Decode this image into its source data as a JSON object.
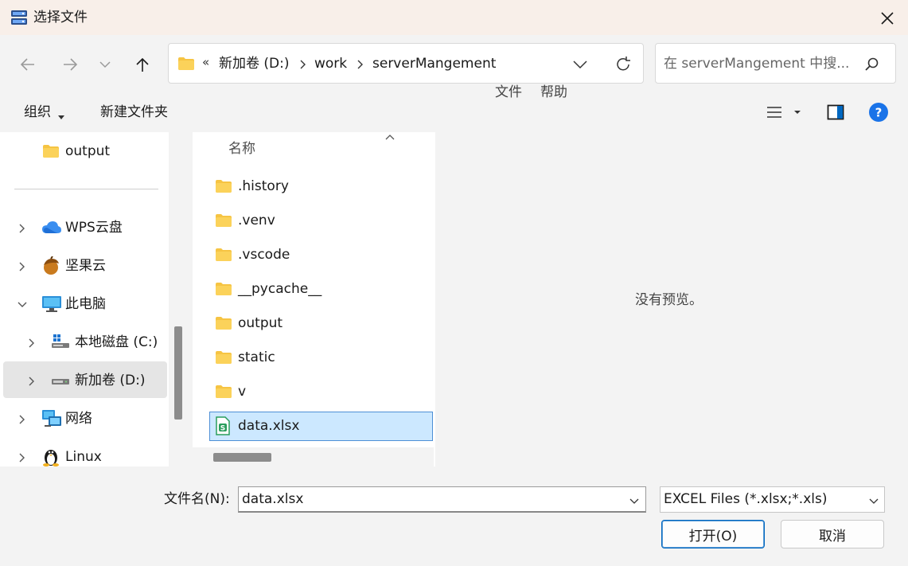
{
  "window": {
    "title": "选择文件"
  },
  "address": {
    "overflow": "«",
    "crumbs": [
      "新加卷 (D:)",
      "work",
      "serverMangement"
    ]
  },
  "search": {
    "placeholder": "在 serverMangement 中搜..."
  },
  "menu": {
    "file": "文件",
    "help": "帮助"
  },
  "toolbar": {
    "organize": "组织",
    "new_folder": "新建文件夹"
  },
  "sidebar": {
    "items": [
      {
        "label": "output",
        "icon": "folder-icon",
        "expandable": false
      },
      {
        "label": "WPS云盘",
        "icon": "cloud-icon",
        "expandable": true
      },
      {
        "label": "坚果云",
        "icon": "nut-icon",
        "expandable": true
      },
      {
        "label": "此电脑",
        "icon": "computer-icon",
        "expandable": true,
        "expanded": true
      },
      {
        "label": "本地磁盘 (C:)",
        "icon": "windows-drive-icon",
        "expandable": true
      },
      {
        "label": "新加卷 (D:)",
        "icon": "drive-icon",
        "expandable": true,
        "selected": true
      },
      {
        "label": "网络",
        "icon": "network-icon",
        "expandable": true
      },
      {
        "label": "Linux",
        "icon": "linux-penguin-icon",
        "expandable": true
      }
    ]
  },
  "files": {
    "column_name": "名称",
    "items": [
      {
        "name": ".history",
        "type": "folder"
      },
      {
        "name": ".venv",
        "type": "folder"
      },
      {
        "name": ".vscode",
        "type": "folder"
      },
      {
        "name": "__pycache__",
        "type": "folder"
      },
      {
        "name": "output",
        "type": "folder"
      },
      {
        "name": "static",
        "type": "folder"
      },
      {
        "name": "v",
        "type": "folder"
      },
      {
        "name": "data.xlsx",
        "type": "spreadsheet",
        "selected": true
      }
    ]
  },
  "preview": {
    "text": "没有预览。"
  },
  "footer": {
    "filename_label": "文件名(N):",
    "filename_value": "data.xlsx",
    "filetype": "EXCEL Files (*.xlsx;*.xls)",
    "open_label": "打开(O)",
    "cancel_label": "取消"
  },
  "colors": {
    "accent": "#0067c0",
    "selection": "#cce8ff",
    "folder": "#f6c443",
    "help": "#1a73e8"
  }
}
